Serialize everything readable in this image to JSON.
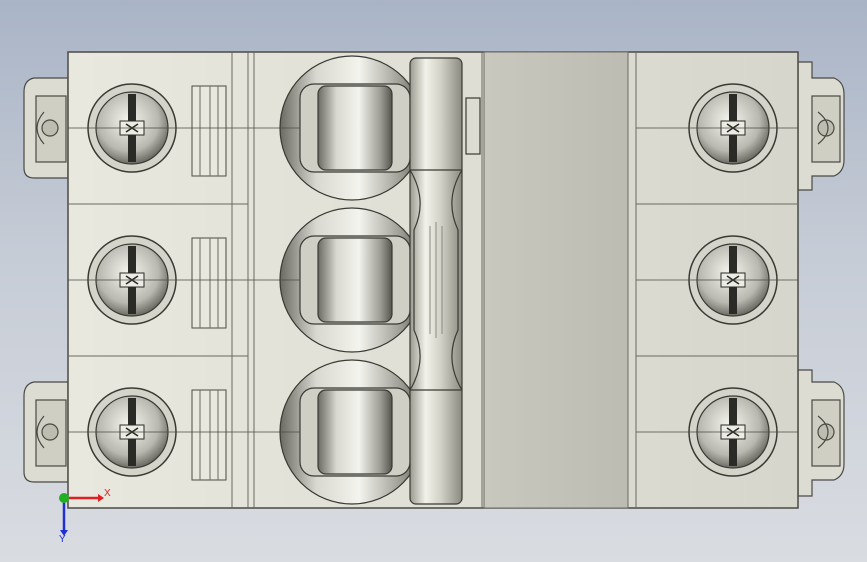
{
  "viewport": {
    "background_top": "#a9b4c6",
    "background_bottom": "#d9dce1"
  },
  "model": {
    "body_color": "#dcdcd2",
    "edge_color": "#4a4a44",
    "handle_color": "#e4e4da",
    "poles": 3,
    "screw_terminals_per_side": 3
  },
  "triad": {
    "x_label": "X",
    "y_label": "Y",
    "x_color": "#e02020",
    "y_color": "#2030d0",
    "origin_color": "#20b020"
  }
}
